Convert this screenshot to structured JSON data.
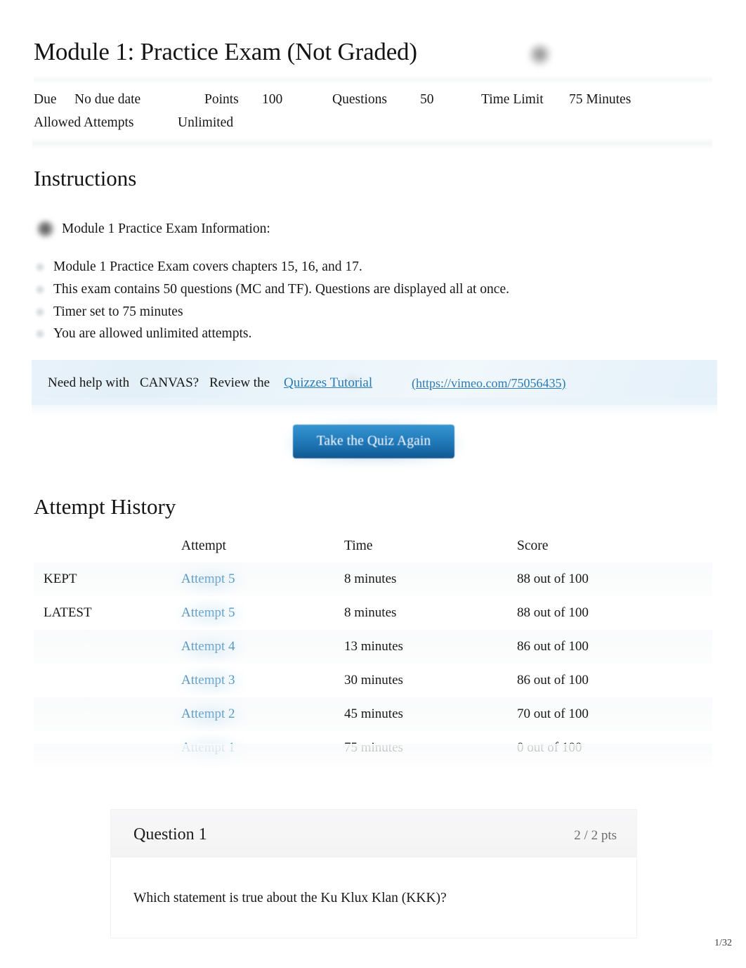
{
  "header": {
    "title": "Module 1: Practice Exam (Not Graded)",
    "published_icon": "published-icon",
    "meta": {
      "due_label": "Due",
      "due_value": "No due date",
      "points_label": "Points",
      "points_value": "100",
      "questions_label": "Questions",
      "questions_value": "50",
      "time_limit_label": "Time Limit",
      "time_limit_value": "75 Minutes",
      "allowed_attempts_label": "Allowed Attempts",
      "allowed_attempts_value": "Unlimited"
    }
  },
  "instructions": {
    "heading": "Instructions",
    "lead": "Module 1 Practice Exam Information:",
    "items": [
      "Module 1 Practice Exam covers chapters 15, 16, and 17.",
      "This exam contains 50 questions (MC and TF). Questions are displayed all at once.",
      "Timer set to 75 minutes",
      "You are allowed unlimited attempts."
    ]
  },
  "info_box": {
    "text_1": "Need help with",
    "text_2": "CANVAS?",
    "text_3": "Review the",
    "link_text": "Quizzes Tutorial",
    "link_url_text": "(https://vimeo.com/75056435)",
    "link_color": "#2a7ab5",
    "background_color": "#e8f2fa"
  },
  "take_quiz_button": {
    "label": "Take the Quiz Again",
    "color": "#1a6fae"
  },
  "attempt_history": {
    "heading": "Attempt History",
    "columns": [
      "",
      "Attempt",
      "Time",
      "Score"
    ],
    "rows": [
      {
        "flag": "KEPT",
        "attempt": "Attempt 5",
        "time": "8 minutes",
        "score": "88 out of 100"
      },
      {
        "flag": "LATEST",
        "attempt": "Attempt 5",
        "time": "8 minutes",
        "score": "88 out of 100"
      },
      {
        "flag": "",
        "attempt": "Attempt 4",
        "time": "13 minutes",
        "score": "86 out of 100"
      },
      {
        "flag": "",
        "attempt": "Attempt 3",
        "time": "30 minutes",
        "score": "86 out of 100"
      },
      {
        "flag": "",
        "attempt": "Attempt 2",
        "time": "45 minutes",
        "score": "70 out of 100"
      },
      {
        "flag": "",
        "attempt": "Attempt 1",
        "time": "75 minutes",
        "score": "0 out of 100"
      }
    ]
  },
  "question": {
    "number": "Question 1",
    "points": "2 / 2 pts",
    "text": "Which statement is true about the Ku Klux Klan (KKK)?"
  },
  "footer": {
    "page_number": "1/32"
  }
}
